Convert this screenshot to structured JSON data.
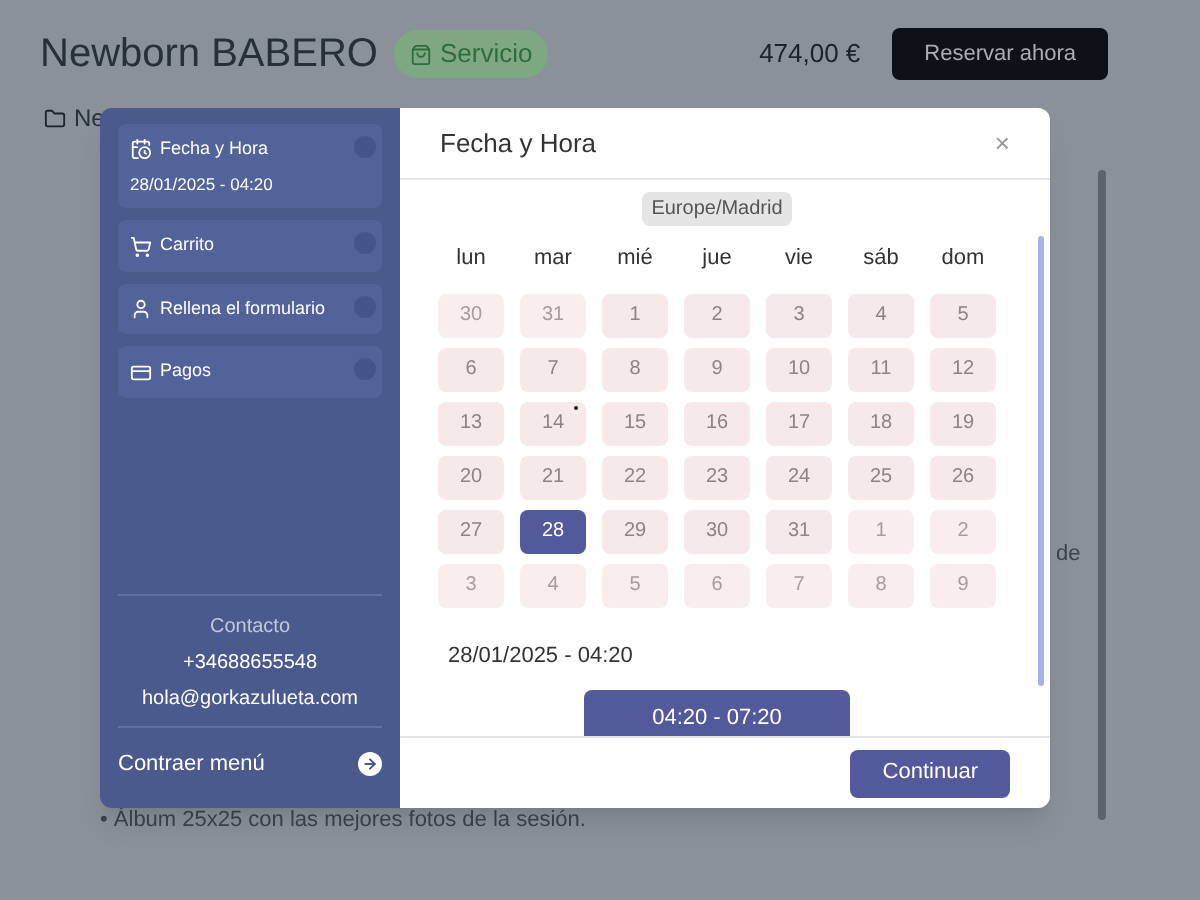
{
  "page": {
    "title": "Newborn BABERO",
    "badge": "Servicio",
    "price": "474,00 €",
    "book_button": "Reservar ahora",
    "breadcrumb": "Ne",
    "side_text": "de",
    "bullet": "• Álbum 25x25 con las mejores fotos de la sesión."
  },
  "sidebar": {
    "steps": [
      {
        "kind": "calendar",
        "label": "Fecha y Hora",
        "detail": "28/01/2025 - 04:20",
        "done": false
      },
      {
        "kind": "cart",
        "label": "Carrito",
        "done": false
      },
      {
        "kind": "user",
        "label": "Rellena el formulario",
        "done": false
      },
      {
        "kind": "card",
        "label": "Pagos",
        "done": false
      }
    ],
    "contact": {
      "heading": "Contacto",
      "phone": "+34688655548",
      "email": "hola@gorkazulueta.com"
    },
    "collapse": "Contraer menú"
  },
  "modal": {
    "title": "Fecha y Hora",
    "close": "×",
    "timezone": "Europe/Madrid",
    "weekdays": [
      "lun",
      "mar",
      "mié",
      "jue",
      "vie",
      "sáb",
      "dom"
    ],
    "days": [
      {
        "label": "30",
        "outside": true,
        "selected": false,
        "today": false
      },
      {
        "label": "31",
        "outside": true,
        "selected": false,
        "today": false
      },
      {
        "label": "1",
        "outside": false,
        "selected": false,
        "today": false
      },
      {
        "label": "2",
        "outside": false,
        "selected": false,
        "today": false
      },
      {
        "label": "3",
        "outside": false,
        "selected": false,
        "today": false
      },
      {
        "label": "4",
        "outside": false,
        "selected": false,
        "today": false
      },
      {
        "label": "5",
        "outside": false,
        "selected": false,
        "today": false
      },
      {
        "label": "6",
        "outside": false,
        "selected": false,
        "today": false
      },
      {
        "label": "7",
        "outside": false,
        "selected": false,
        "today": false
      },
      {
        "label": "8",
        "outside": false,
        "selected": false,
        "today": false
      },
      {
        "label": "9",
        "outside": false,
        "selected": false,
        "today": false
      },
      {
        "label": "10",
        "outside": false,
        "selected": false,
        "today": false
      },
      {
        "label": "11",
        "outside": false,
        "selected": false,
        "today": false
      },
      {
        "label": "12",
        "outside": false,
        "selected": false,
        "today": false
      },
      {
        "label": "13",
        "outside": false,
        "selected": false,
        "today": false
      },
      {
        "label": "14",
        "outside": false,
        "selected": false,
        "today": true
      },
      {
        "label": "15",
        "outside": false,
        "selected": false,
        "today": false
      },
      {
        "label": "16",
        "outside": false,
        "selected": false,
        "today": false
      },
      {
        "label": "17",
        "outside": false,
        "selected": false,
        "today": false
      },
      {
        "label": "18",
        "outside": false,
        "selected": false,
        "today": false
      },
      {
        "label": "19",
        "outside": false,
        "selected": false,
        "today": false
      },
      {
        "label": "20",
        "outside": false,
        "selected": false,
        "today": false
      },
      {
        "label": "21",
        "outside": false,
        "selected": false,
        "today": false
      },
      {
        "label": "22",
        "outside": false,
        "selected": false,
        "today": false
      },
      {
        "label": "23",
        "outside": false,
        "selected": false,
        "today": false
      },
      {
        "label": "24",
        "outside": false,
        "selected": false,
        "today": false
      },
      {
        "label": "25",
        "outside": false,
        "selected": false,
        "today": false
      },
      {
        "label": "26",
        "outside": false,
        "selected": false,
        "today": false
      },
      {
        "label": "27",
        "outside": false,
        "selected": false,
        "today": false
      },
      {
        "label": "28",
        "outside": false,
        "selected": true,
        "today": false
      },
      {
        "label": "29",
        "outside": false,
        "selected": false,
        "today": false
      },
      {
        "label": "30",
        "outside": false,
        "selected": false,
        "today": false
      },
      {
        "label": "31",
        "outside": false,
        "selected": false,
        "today": false
      },
      {
        "label": "1",
        "outside": true,
        "selected": false,
        "today": false
      },
      {
        "label": "2",
        "outside": true,
        "selected": false,
        "today": false
      },
      {
        "label": "3",
        "outside": true,
        "selected": false,
        "today": false
      },
      {
        "label": "4",
        "outside": true,
        "selected": false,
        "today": false
      },
      {
        "label": "5",
        "outside": true,
        "selected": false,
        "today": false
      },
      {
        "label": "6",
        "outside": true,
        "selected": false,
        "today": false
      },
      {
        "label": "7",
        "outside": true,
        "selected": false,
        "today": false
      },
      {
        "label": "8",
        "outside": true,
        "selected": false,
        "today": false
      },
      {
        "label": "9",
        "outside": true,
        "selected": false,
        "today": false
      }
    ],
    "chosen": "28/01/2025 - 04:20",
    "slots": [
      {
        "label": "04:20 - 07:20",
        "selected": true
      }
    ],
    "continue": "Continuar"
  }
}
